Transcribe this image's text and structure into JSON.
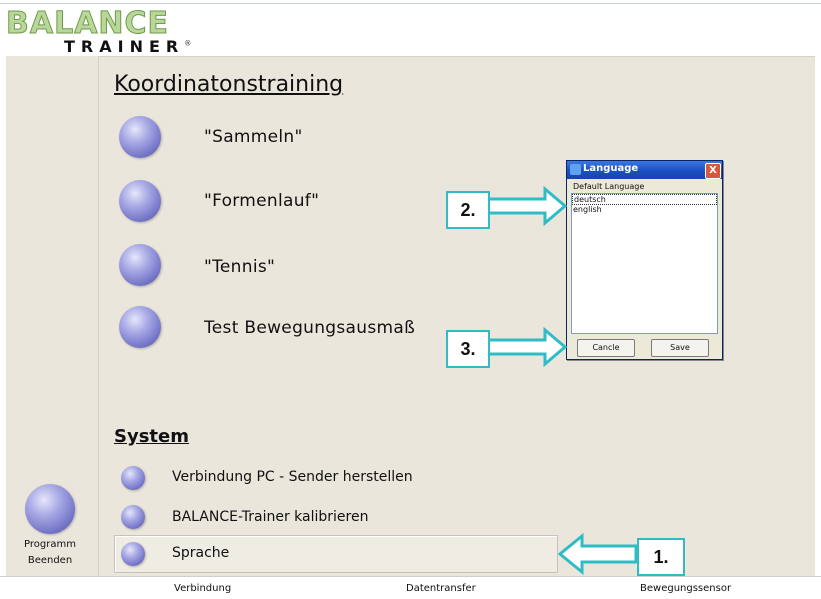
{
  "logo": {
    "line1": "BALANCE",
    "line2": "TRAINER",
    "mark": "®"
  },
  "colors": {
    "ball": "#6e6fc4",
    "callout_border": "#2fbcc4",
    "panel_bg": "#eae6dc",
    "titlebar": "#1b4fc2"
  },
  "sidebar": {
    "quit_line1": "Programm",
    "quit_line2": "Beenden"
  },
  "training": {
    "title": "Koordinatonstraining",
    "items": [
      {
        "label": "\"Sammeln\""
      },
      {
        "label": "\"Formenlauf\""
      },
      {
        "label": "\"Tennis\""
      },
      {
        "label": "Test Bewegungsausmaß"
      }
    ]
  },
  "system": {
    "title": "System",
    "items": [
      {
        "label": "Verbindung PC - Sender herstellen"
      },
      {
        "label": "BALANCE-Trainer kalibrieren"
      },
      {
        "label": "Sprache"
      }
    ]
  },
  "statusbar": {
    "left": "Verbindung",
    "middle": "Datentransfer",
    "right": "Bewegungssensor"
  },
  "dialog": {
    "title": "Language",
    "close": "X",
    "group_label": "Default Language",
    "options": [
      "deutsch",
      "english"
    ],
    "selected": "deutsch",
    "cancel_label": "Cancle",
    "save_label": "Save"
  },
  "callouts": {
    "one": "1.",
    "two": "2.",
    "three": "3."
  }
}
